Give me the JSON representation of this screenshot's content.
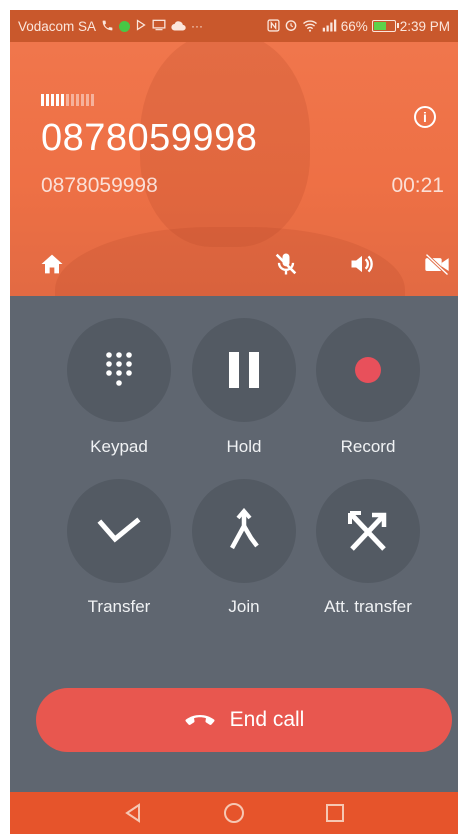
{
  "status_bar": {
    "carrier": "Vodacom SA",
    "battery_percent": "66%",
    "battery_level": 0.66,
    "time": "2:39 PM",
    "icons_left": [
      "phone-icon",
      "green-dot-icon",
      "play-store-icon",
      "cast-icon",
      "cloud-icon",
      "more-icon"
    ],
    "icons_right": [
      "nfc-icon",
      "alarm-icon",
      "wifi-icon",
      "cell-signal-icon",
      "battery-icon"
    ]
  },
  "call": {
    "name": "0878059998",
    "number": "0878059998",
    "duration": "00:21",
    "signal_strength": 5,
    "signal_max": 11
  },
  "header_controls": [
    "home-icon",
    "mute-mic-icon",
    "speaker-icon",
    "video-off-icon"
  ],
  "actions": [
    {
      "label": "Keypad",
      "icon": "keypad-icon"
    },
    {
      "label": "Hold",
      "icon": "pause-icon"
    },
    {
      "label": "Record",
      "icon": "record-icon"
    },
    {
      "label": "Transfer",
      "icon": "transfer-icon"
    },
    {
      "label": "Join",
      "icon": "merge-icon"
    },
    {
      "label": "Att. transfer",
      "icon": "attended-transfer-icon"
    }
  ],
  "end_call": {
    "label": "End call",
    "icon": "hangup-icon"
  },
  "nav": [
    "back-icon",
    "home-circle-icon",
    "recents-icon"
  ],
  "colors": {
    "status_bar": "#c9582c",
    "header_accent": "#ee7045",
    "background": "#5f6670",
    "button": "#535a63",
    "end_call": "#e8574f",
    "record_dot": "#e8505b",
    "nav_bar": "#e6542b"
  }
}
